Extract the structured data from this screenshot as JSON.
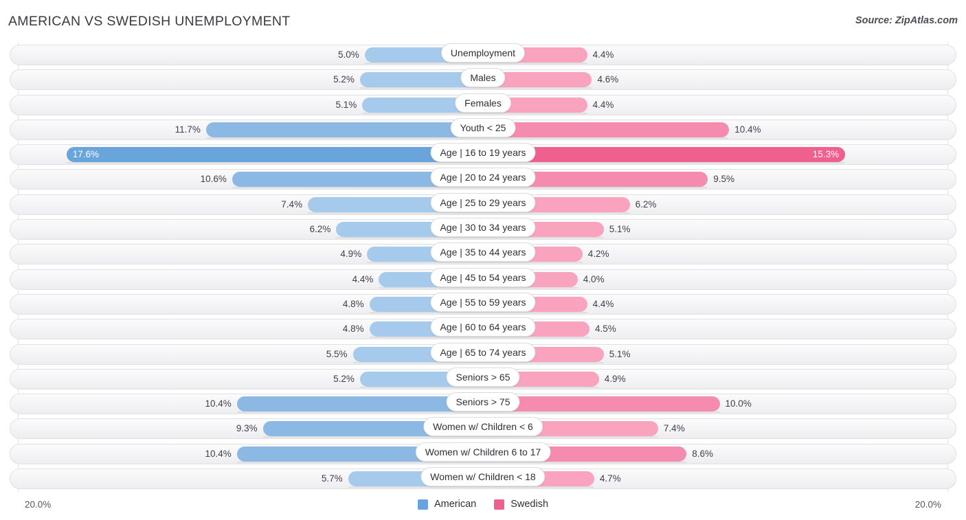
{
  "header": {
    "title": "AMERICAN VS SWEDISH UNEMPLOYMENT",
    "source": "Source: ZipAtlas.com"
  },
  "footer": {
    "axis_left": "20.0%",
    "axis_right": "20.0%",
    "legend": [
      {
        "label": "American",
        "color": "#6aa4dd"
      },
      {
        "label": "Swedish",
        "color": "#f0608f"
      }
    ]
  },
  "colors": {
    "american_light": "#a6caec",
    "american_mid": "#8cb8e4",
    "american_dark": "#6aa4dd",
    "swedish_light": "#f9a3bf",
    "swedish_mid": "#f58caf",
    "swedish_dark": "#f0608f",
    "track_border": "#e0e0e3",
    "text": "#3f3f46"
  },
  "chart_data": {
    "type": "bar",
    "title": "AMERICAN VS SWEDISH UNEMPLOYMENT",
    "subtitle": "Source: ZipAtlas.com",
    "orientation": "horizontal-diverging",
    "xlabel": "",
    "ylabel": "",
    "xlim": [
      0,
      20.0
    ],
    "axis_max_label": "20.0%",
    "grid": false,
    "legend_position": "bottom-center",
    "categories": [
      "Unemployment",
      "Males",
      "Females",
      "Youth < 25",
      "Age | 16 to 19 years",
      "Age | 20 to 24 years",
      "Age | 25 to 29 years",
      "Age | 30 to 34 years",
      "Age | 35 to 44 years",
      "Age | 45 to 54 years",
      "Age | 55 to 59 years",
      "Age | 60 to 64 years",
      "Age | 65 to 74 years",
      "Seniors > 65",
      "Seniors > 75",
      "Women w/ Children < 6",
      "Women w/ Children 6 to 17",
      "Women w/ Children < 18"
    ],
    "series": [
      {
        "name": "American",
        "side": "left",
        "values": [
          5.0,
          5.2,
          5.1,
          11.7,
          17.6,
          10.6,
          7.4,
          6.2,
          4.9,
          4.4,
          4.8,
          4.8,
          5.5,
          5.2,
          10.4,
          9.3,
          10.4,
          5.7
        ],
        "labels": [
          "5.0%",
          "5.2%",
          "5.1%",
          "11.7%",
          "17.6%",
          "10.6%",
          "7.4%",
          "6.2%",
          "4.9%",
          "4.4%",
          "4.8%",
          "4.8%",
          "5.5%",
          "5.2%",
          "10.4%",
          "9.3%",
          "10.4%",
          "5.7%"
        ]
      },
      {
        "name": "Swedish",
        "side": "right",
        "values": [
          4.4,
          4.6,
          4.4,
          10.4,
          15.3,
          9.5,
          6.2,
          5.1,
          4.2,
          4.0,
          4.4,
          4.5,
          5.1,
          4.9,
          10.0,
          7.4,
          8.6,
          4.7
        ],
        "labels": [
          "4.4%",
          "4.6%",
          "4.4%",
          "10.4%",
          "15.3%",
          "9.5%",
          "6.2%",
          "5.1%",
          "4.2%",
          "4.0%",
          "4.4%",
          "4.5%",
          "5.1%",
          "4.9%",
          "10.0%",
          "7.4%",
          "8.6%",
          "4.7%"
        ]
      }
    ]
  }
}
